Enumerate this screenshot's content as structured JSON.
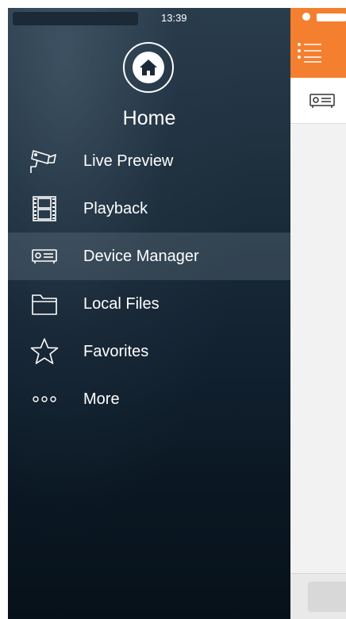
{
  "status_bar": {
    "time": "13:39"
  },
  "drawer": {
    "home_label": "Home",
    "home_icon": "house-icon",
    "items": [
      {
        "label": "Live Preview",
        "icon": "camera-icon",
        "active": false
      },
      {
        "label": "Playback",
        "icon": "film-icon",
        "active": false
      },
      {
        "label": "Device Manager",
        "icon": "dvr-icon",
        "active": true
      },
      {
        "label": "Local Files",
        "icon": "folder-icon",
        "active": false
      },
      {
        "label": "Favorites",
        "icon": "star-icon",
        "active": false
      },
      {
        "label": "More",
        "icon": "more-dots-icon",
        "active": false
      }
    ]
  },
  "page": {
    "header_color": "#f47f2e",
    "menu_icon": "list-menu-icon",
    "tab_icon": "dvr-icon"
  },
  "colors": {
    "accent": "#f47f2e",
    "drawer_top": "#2a3d4d",
    "drawer_bottom": "#07111a",
    "text": "#ffffff"
  }
}
